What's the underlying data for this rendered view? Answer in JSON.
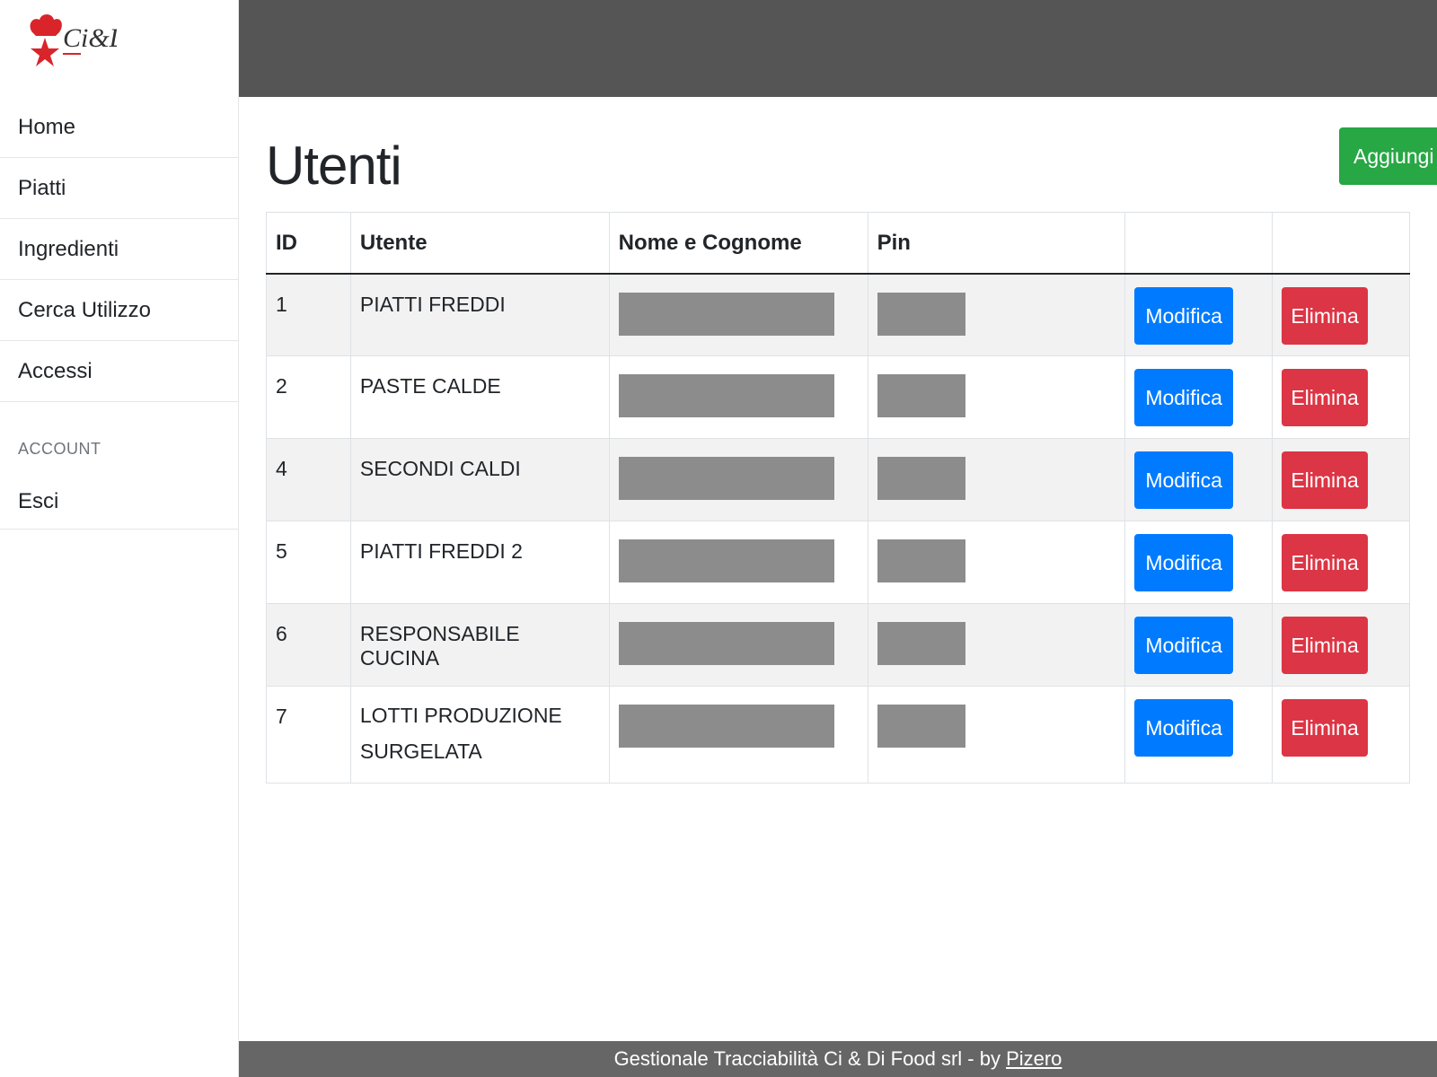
{
  "logo": {
    "text": "Ci&Di"
  },
  "sidebar": {
    "items": [
      {
        "label": "Home"
      },
      {
        "label": "Piatti"
      },
      {
        "label": "Ingredienti"
      },
      {
        "label": "Cerca Utilizzo"
      },
      {
        "label": "Accessi"
      }
    ],
    "account_heading": "ACCOUNT",
    "exit_label": "Esci"
  },
  "page": {
    "title": "Utenti",
    "add_label": "Aggiungi"
  },
  "table": {
    "headers": [
      "ID",
      "Utente",
      "Nome e Cognome",
      "Pin",
      "",
      ""
    ],
    "edit_label": "Modifica",
    "delete_label": "Elimina",
    "rows": [
      {
        "id": "1",
        "utente": "PIATTI FREDDI"
      },
      {
        "id": "2",
        "utente": "PASTE CALDE"
      },
      {
        "id": "4",
        "utente": "SECONDI CALDI"
      },
      {
        "id": "5",
        "utente": "PIATTI FREDDI 2"
      },
      {
        "id": "6",
        "utente": "RESPONSABILE CUCINA"
      },
      {
        "id": "7",
        "utente": "LOTTI PRODUZIONE SURGELATA"
      }
    ]
  },
  "footer": {
    "text": "Gestionale Tracciabilità Ci & Di Food srl - by ",
    "link": "Pizero"
  },
  "colors": {
    "topbar": "#555555",
    "add": "#28a745",
    "edit": "#007bff",
    "delete": "#dc3545",
    "logo_red": "#d9252a"
  }
}
